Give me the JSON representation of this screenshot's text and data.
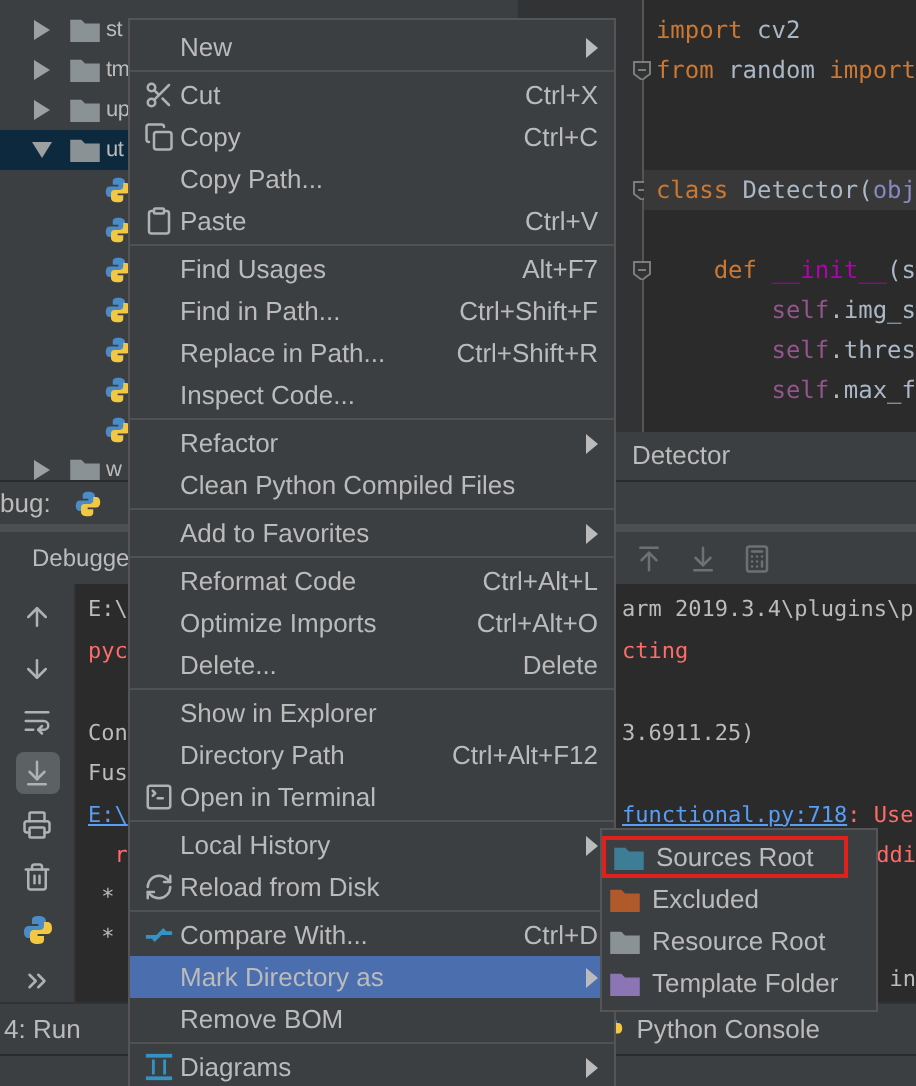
{
  "project_tree": [
    {
      "label": "st",
      "expanded": false,
      "selected": false
    },
    {
      "label": "tm",
      "expanded": false,
      "selected": false
    },
    {
      "label": "up",
      "expanded": false,
      "selected": false
    },
    {
      "label": "ut",
      "expanded": true,
      "selected": true,
      "children": [
        {
          "kind": "python-file"
        },
        {
          "kind": "python-file"
        },
        {
          "kind": "python-file"
        },
        {
          "kind": "python-file"
        },
        {
          "kind": "python-file"
        },
        {
          "kind": "python-file"
        },
        {
          "kind": "python-file"
        }
      ]
    },
    {
      "label": "w",
      "expanded": false,
      "selected": false
    }
  ],
  "editor": {
    "lines": [
      {
        "kind": "code",
        "fold": false,
        "current": false,
        "tokens": [
          {
            "text": "import",
            "kind": "keyword"
          },
          {
            "text": " cv2",
            "kind": "name"
          }
        ]
      },
      {
        "kind": "code",
        "fold": true,
        "current": false,
        "tokens": [
          {
            "text": "from",
            "kind": "keyword"
          },
          {
            "text": " random ",
            "kind": "name"
          },
          {
            "text": "import",
            "kind": "keyword"
          }
        ]
      },
      {
        "kind": "blank"
      },
      {
        "kind": "blank"
      },
      {
        "kind": "code",
        "fold": true,
        "current": true,
        "tokens": [
          {
            "text": "class",
            "kind": "keyword"
          },
          {
            "text": " Detector(",
            "kind": "name"
          },
          {
            "text": "obj",
            "kind": "builtin"
          }
        ]
      },
      {
        "kind": "blank"
      },
      {
        "kind": "code",
        "fold": true,
        "current": false,
        "tokens": [
          {
            "text": "    def ",
            "kind": "keyword"
          },
          {
            "text": "__init__",
            "kind": "magic"
          },
          {
            "text": "(s",
            "kind": "name"
          }
        ]
      },
      {
        "kind": "code",
        "fold": false,
        "current": false,
        "tokens": [
          {
            "text": "        self",
            "kind": "self"
          },
          {
            "text": ".img_s",
            "kind": "name"
          }
        ]
      },
      {
        "kind": "code",
        "fold": false,
        "current": false,
        "tokens": [
          {
            "text": "        self",
            "kind": "self"
          },
          {
            "text": ".thres",
            "kind": "name"
          }
        ]
      },
      {
        "kind": "code",
        "fold": false,
        "current": false,
        "tokens": [
          {
            "text": "        self",
            "kind": "self"
          },
          {
            "text": ".max_f",
            "kind": "name"
          }
        ]
      }
    ],
    "breadcrumb": "Detector"
  },
  "debug_panel": {
    "title": "bug:",
    "tab": "Debugge",
    "toolbar": [
      {
        "selected": false
      },
      {
        "selected": false
      },
      {
        "selected": false
      },
      {
        "selected": true
      },
      {
        "selected": false
      },
      {
        "selected": false
      },
      {
        "selected": false
      },
      {
        "selected": false
      }
    ],
    "console_rows": [
      {
        "left": [
          {
            "text": "E:\\",
            "kind": "plain"
          }
        ],
        "right": [
          {
            "text": "arm 2019.3.4\\plugins\\p",
            "kind": "plain"
          }
        ]
      },
      {
        "left": [
          {
            "text": "pyc",
            "kind": "error"
          }
        ],
        "right": [
          {
            "text": "cting",
            "kind": "error"
          }
        ]
      },
      {},
      {
        "left": [
          {
            "text": "Con",
            "kind": "plain"
          }
        ],
        "right": [
          {
            "text": "3.6911.25)",
            "kind": "plain"
          }
        ]
      },
      {
        "left": [
          {
            "text": "Fus",
            "kind": "plain"
          }
        ]
      },
      {
        "left": [
          {
            "text": "E:\\",
            "kind": "link"
          }
        ],
        "right": [
          {
            "text": "functional.py:718",
            "kind": "link"
          },
          {
            "text": ": Use",
            "kind": "error"
          }
        ]
      },
      {
        "left": [
          {
            "text": "  r",
            "kind": "error"
          }
        ],
        "right": [
          {
            "text": "ddi",
            "kind": "error",
            "partly_hidden": true
          }
        ]
      },
      {
        "left": [
          {
            "text": " *",
            "kind": "plain"
          }
        ]
      },
      {
        "left": [
          {
            "text": " *",
            "kind": "plain"
          }
        ]
      },
      {
        "right": [
          {
            "text": "in",
            "kind": "plain",
            "partly_hidden": true
          }
        ]
      }
    ]
  },
  "bottom_tabs": [
    {
      "label": "4: Run"
    },
    {
      "label": "Python Console"
    }
  ],
  "context_menu": {
    "groups": [
      [
        {
          "label": "New",
          "submenu": true,
          "selected": false
        }
      ],
      [
        {
          "label": "Cut",
          "shortcut": "Ctrl+X",
          "submenu": false,
          "selected": false
        },
        {
          "label": "Copy",
          "shortcut": "Ctrl+C",
          "submenu": false,
          "selected": false
        },
        {
          "label": "Copy Path...",
          "submenu": false,
          "selected": false
        },
        {
          "label": "Paste",
          "shortcut": "Ctrl+V",
          "submenu": false,
          "selected": false
        }
      ],
      [
        {
          "label": "Find Usages",
          "shortcut": "Alt+F7",
          "submenu": false,
          "selected": false
        },
        {
          "label": "Find in Path...",
          "shortcut": "Ctrl+Shift+F",
          "submenu": false,
          "selected": false
        },
        {
          "label": "Replace in Path...",
          "shortcut": "Ctrl+Shift+R",
          "submenu": false,
          "selected": false
        },
        {
          "label": "Inspect Code...",
          "submenu": false,
          "selected": false
        }
      ],
      [
        {
          "label": "Refactor",
          "submenu": true,
          "selected": false
        },
        {
          "label": "Clean Python Compiled Files",
          "submenu": false,
          "selected": false
        }
      ],
      [
        {
          "label": "Add to Favorites",
          "submenu": true,
          "selected": false
        }
      ],
      [
        {
          "label": "Reformat Code",
          "shortcut": "Ctrl+Alt+L",
          "submenu": false,
          "selected": false
        },
        {
          "label": "Optimize Imports",
          "shortcut": "Ctrl+Alt+O",
          "submenu": false,
          "selected": false
        },
        {
          "label": "Delete...",
          "shortcut": "Delete",
          "submenu": false,
          "selected": false
        }
      ],
      [
        {
          "label": "Show in Explorer",
          "submenu": false,
          "selected": false
        },
        {
          "label": "Directory Path",
          "shortcut": "Ctrl+Alt+F12",
          "submenu": false,
          "selected": false
        },
        {
          "label": "Open in Terminal",
          "submenu": false,
          "selected": false
        }
      ],
      [
        {
          "label": "Local History",
          "submenu": true,
          "selected": false
        },
        {
          "label": "Reload from Disk",
          "submenu": false,
          "selected": false
        }
      ],
      [
        {
          "label": "Compare With...",
          "shortcut": "Ctrl+D",
          "submenu": false,
          "selected": false
        },
        {
          "label": "Mark Directory as",
          "submenu": true,
          "selected": true
        },
        {
          "label": "Remove BOM",
          "submenu": false,
          "selected": false
        }
      ],
      [
        {
          "label": "Diagrams",
          "submenu": true,
          "selected": false
        }
      ]
    ]
  },
  "submenu": [
    {
      "label": "Sources Root",
      "color": "#3d7d96",
      "outlined": true
    },
    {
      "label": "Excluded",
      "color": "#b0592b",
      "outlined": false
    },
    {
      "label": "Resource Root",
      "color": "#8a9296",
      "outlined": false
    },
    {
      "label": "Template Folder",
      "color": "#8c75b5",
      "outlined": false
    }
  ]
}
